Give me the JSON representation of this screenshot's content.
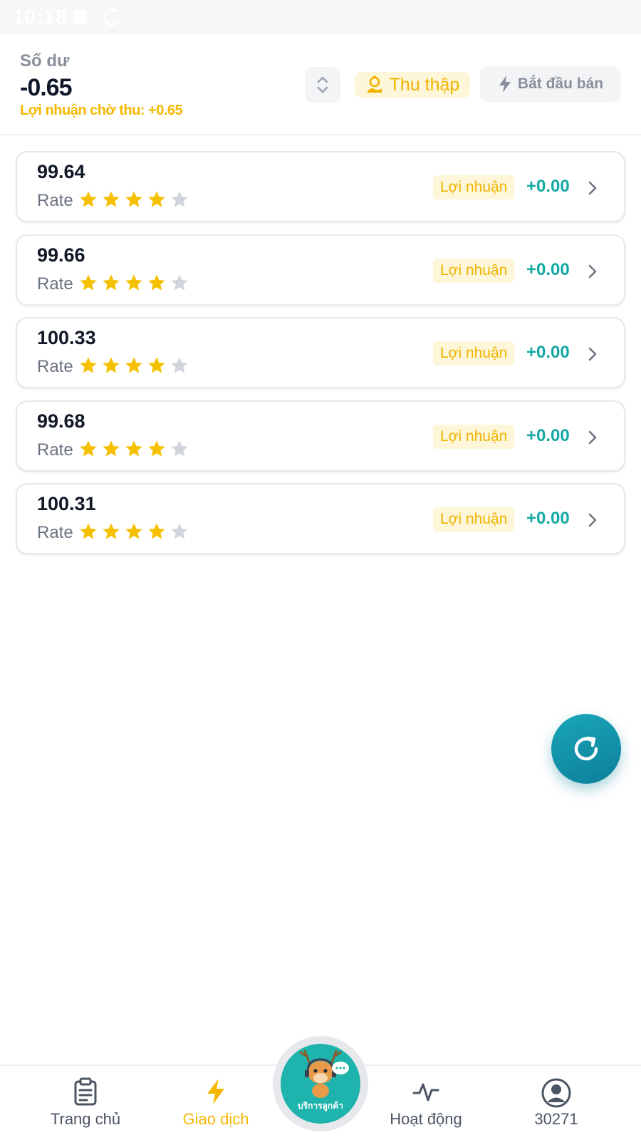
{
  "status_bar": {
    "time": "10:18"
  },
  "header": {
    "balance_label": "Số dư",
    "balance_value": "-0.65",
    "pending_profit": "Lợi nhuận chờ thu: +0.65",
    "collect_label": "Thu thập",
    "sell_label": "Bắt đầu bán"
  },
  "items": [
    {
      "value": "99.64",
      "rate_label": "Rate",
      "rating": 4,
      "profit_label": "Lợi nhuận",
      "profit": "+0.00"
    },
    {
      "value": "99.66",
      "rate_label": "Rate",
      "rating": 4,
      "profit_label": "Lợi nhuận",
      "profit": "+0.00"
    },
    {
      "value": "100.33",
      "rate_label": "Rate",
      "rating": 4,
      "profit_label": "Lợi nhuận",
      "profit": "+0.00"
    },
    {
      "value": "99.68",
      "rate_label": "Rate",
      "rating": 4,
      "profit_label": "Lợi nhuận",
      "profit": "+0.00"
    },
    {
      "value": "100.31",
      "rate_label": "Rate",
      "rating": 4,
      "profit_label": "Lợi nhuận",
      "profit": "+0.00"
    }
  ],
  "bottom_nav": {
    "items": [
      {
        "label": "Trang chủ",
        "icon": "clipboard-icon",
        "active": false
      },
      {
        "label": "Giao dịch",
        "icon": "lightning-icon",
        "active": true
      },
      {
        "label": "Hoạt động",
        "icon": "activity-icon",
        "active": false
      },
      {
        "label": "30271",
        "icon": "user-icon",
        "active": false
      }
    ],
    "support_label": "บริการลูกค้า"
  },
  "colors": {
    "accent_yellow": "#f5b800",
    "profit_teal": "#14a9a4",
    "fab_teal": "#0c7f99",
    "star_filled": "#f5c000",
    "star_empty": "#d1d5db"
  }
}
